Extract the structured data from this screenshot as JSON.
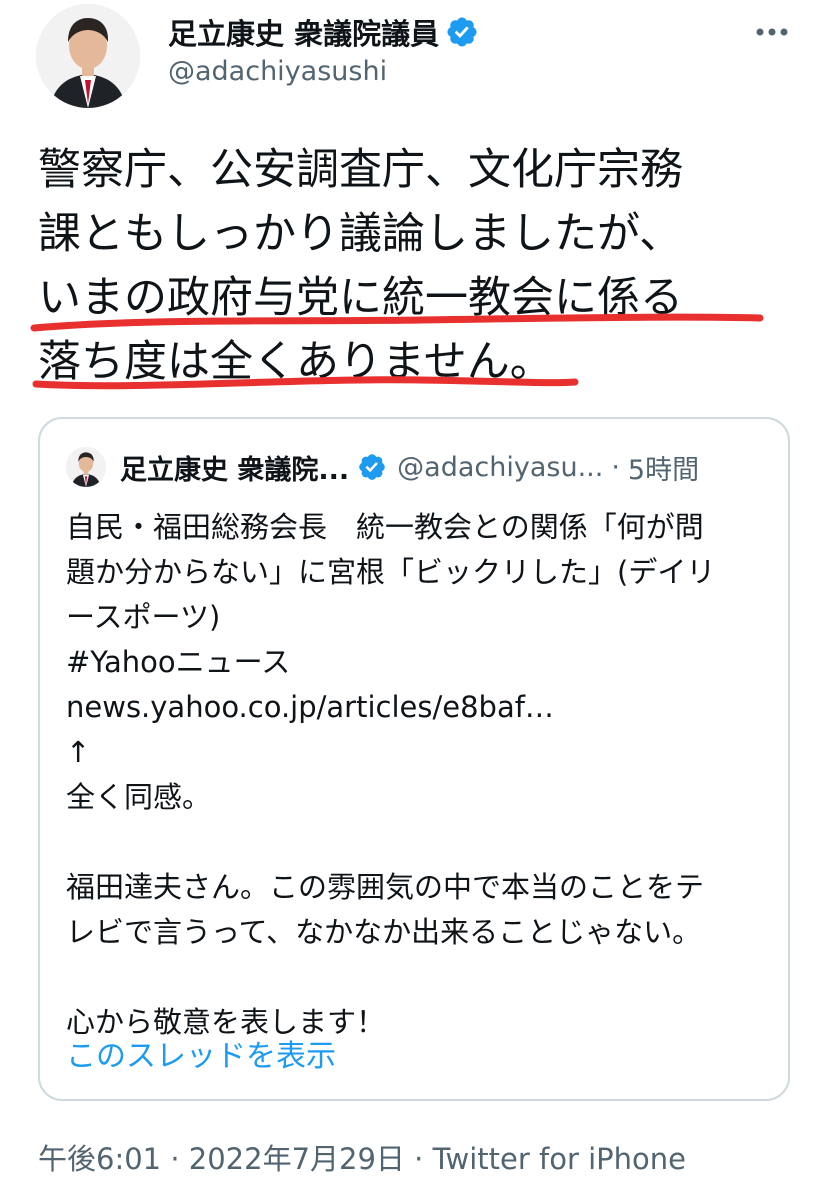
{
  "author": {
    "display_name": "足立康史 衆議院議員",
    "handle": "@adachiyasushi",
    "verified_icon": "verified-badge-icon",
    "avatar_icon": "avatar"
  },
  "more_icon": "more-dots-icon",
  "tweet": {
    "lines": [
      "警察庁、公安調査庁、文化庁宗務",
      "課ともしっかり議論しましたが、",
      "いまの政府与党に統一教会に係る",
      "落ち度は全くありません。"
    ],
    "highlight_color": "#e8302f"
  },
  "quoted": {
    "display_name": "足立康史 衆議院...",
    "handle": "@adachiyasu...",
    "separator": "·",
    "time": "5時間",
    "body_lines": [
      "自民・福田総務会長　統一教会との関係「何が問",
      "題か分からない」に宮根「ビックリした」(デイリ",
      "ースポーツ)",
      "#Yahooニュース",
      "news.yahoo.co.jp/articles/e8baf…",
      "↑",
      "全く同感。",
      "",
      "福田達夫さん。この雰囲気の中で本当のことをテ",
      "レビで言うって、なかなか出来ることじゃない。",
      "",
      "心から敬意を表します！"
    ],
    "show_thread": "このスレッドを表示"
  },
  "meta": {
    "time": "午後6:01",
    "sep1": " · ",
    "date": "2022年7月29日",
    "sep2": " · ",
    "source": "Twitter for iPhone"
  },
  "colors": {
    "text": "#0f1419",
    "muted": "#536471",
    "link": "#1d9bf0",
    "verified": "#1d9bf0",
    "border": "#cfd9de"
  }
}
